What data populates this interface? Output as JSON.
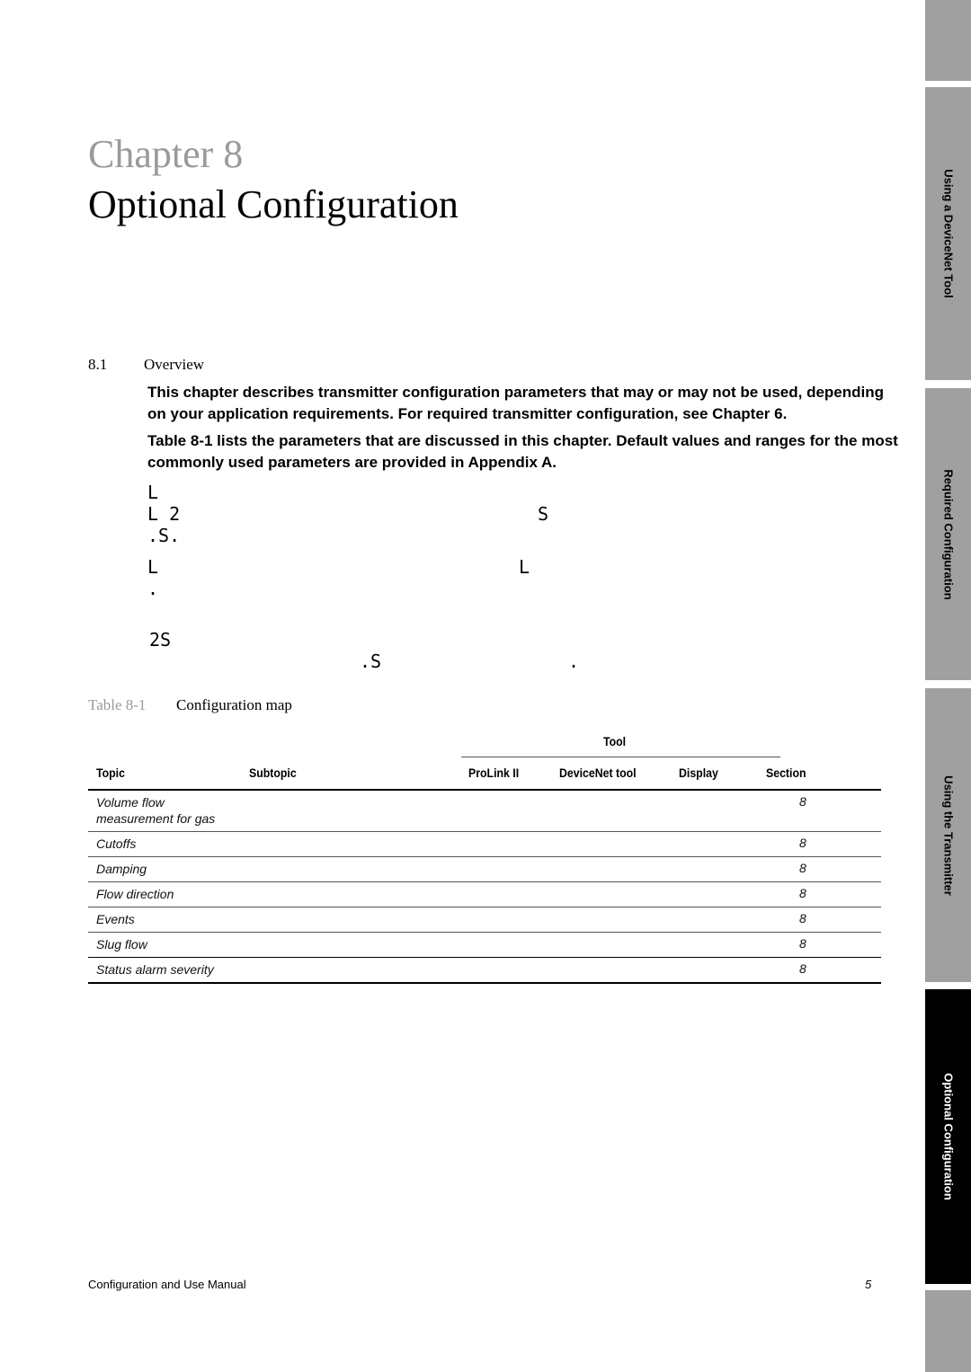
{
  "chapter": {
    "label": "Chapter 8",
    "title": "Optional Configuration"
  },
  "section": {
    "number": "8.1",
    "title": "Overview"
  },
  "paragraphs": [
    {
      "line1": "This chapter describes transmitter configuration parameters that may or may not be used, depending",
      "line2": "on your application requirements. For required transmitter configuration, see Chapter 6."
    },
    {
      "line1": "Table 8-1 lists the parameters that are discussed in this chapter. Default values and ranges for the most",
      "line2": "commonly used parameters are provided in Appendix A."
    }
  ],
  "stray_glyphs": [
    "L",
    "L 2",
    "S",
    ".S.",
    "L",
    "L",
    ".",
    "2S",
    ".S",
    "."
  ],
  "table": {
    "caption_label": "Table 8-1",
    "caption_title": "Configuration map",
    "group_header": "Tool",
    "headers": [
      "Topic",
      "Subtopic",
      "ProLink II",
      "DeviceNet tool",
      "Display",
      "Section"
    ],
    "rows": [
      {
        "topic_line1": "Volume flow",
        "topic_line2": "measurement for gas",
        "subtopic": "",
        "prolink": "",
        "devicenet": "",
        "display": "",
        "section": "8"
      },
      {
        "topic_line1": "Cutoffs",
        "topic_line2": "",
        "subtopic": "",
        "prolink": "",
        "devicenet": "",
        "display": "",
        "section": "8"
      },
      {
        "topic_line1": "Damping",
        "topic_line2": "",
        "subtopic": "",
        "prolink": "",
        "devicenet": "",
        "display": "",
        "section": "8"
      },
      {
        "topic_line1": "Flow direction",
        "topic_line2": "",
        "subtopic": "",
        "prolink": "",
        "devicenet": "",
        "display": "",
        "section": "8"
      },
      {
        "topic_line1": "Events",
        "topic_line2": "",
        "subtopic": "",
        "prolink": "",
        "devicenet": "",
        "display": "",
        "section": "8"
      },
      {
        "topic_line1": "Slug flow",
        "topic_line2": "",
        "subtopic": "",
        "prolink": "",
        "devicenet": "",
        "display": "",
        "section": "8"
      },
      {
        "topic_line1": "Status alarm severity",
        "topic_line2": "",
        "subtopic": "",
        "prolink": "",
        "devicenet": "",
        "display": "",
        "section": "8"
      }
    ]
  },
  "side_tabs": [
    {
      "label": "",
      "active": false
    },
    {
      "label": "Using a DeviceNet Tool",
      "active": false
    },
    {
      "label": "Required Configuration",
      "active": false
    },
    {
      "label": "Using the Transmitter",
      "active": false
    },
    {
      "label": "Optional Configuration",
      "active": true
    },
    {
      "label": "",
      "active": false
    }
  ],
  "footer": {
    "manual_title": "Configuration and Use Manual",
    "page_number": "5"
  }
}
